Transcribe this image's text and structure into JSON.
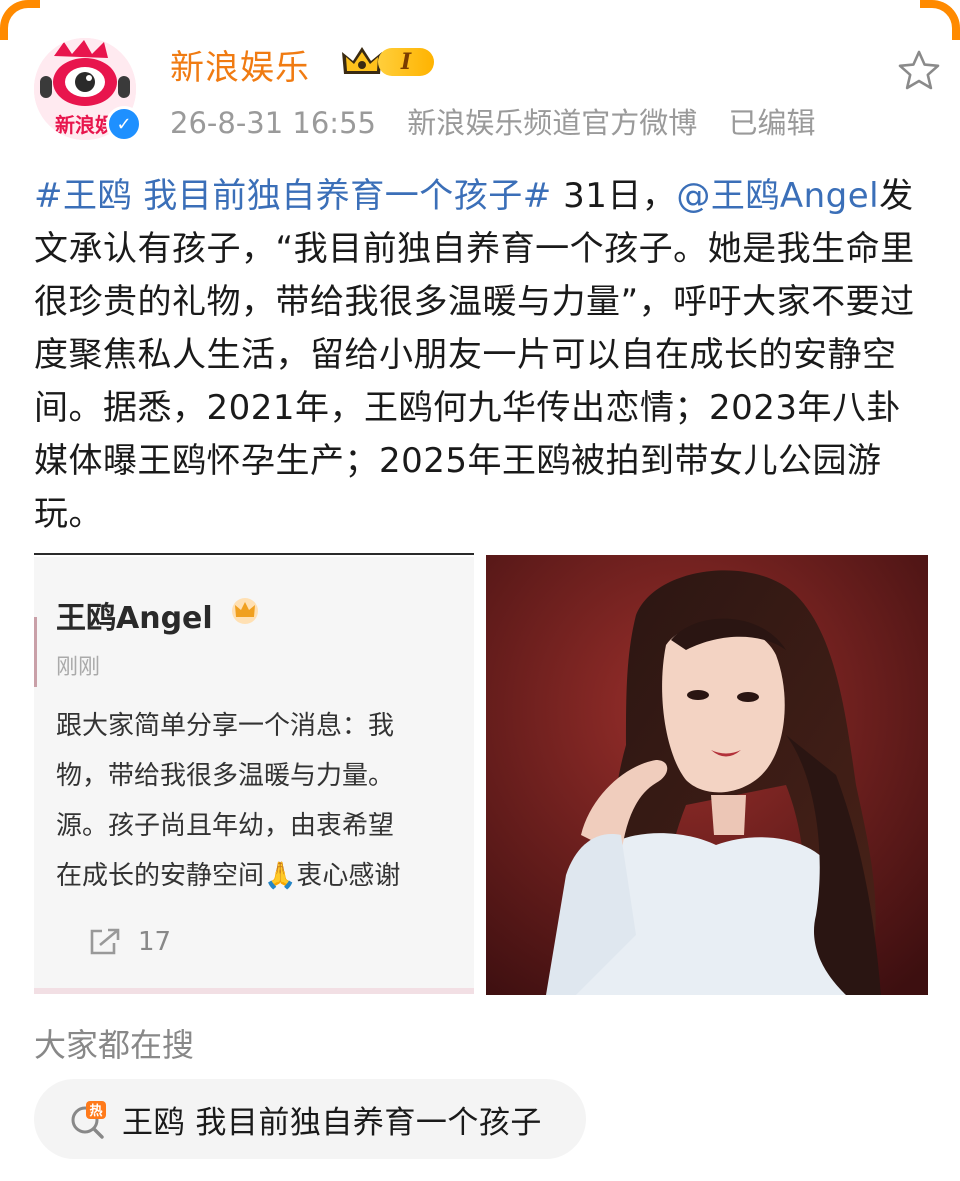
{
  "account": {
    "name": "新浪娱乐",
    "level_badge": "I",
    "timestamp": "26-8-31 16:55",
    "source": "新浪娱乐频道官方微博",
    "edited": "已编辑",
    "avatar_text": "新浪娱",
    "verified_mark": "✓"
  },
  "post": {
    "topic": "#王鸥 我目前独自养育一个孩子#",
    "text1": " 31日，",
    "mention": "@王鸥Angel",
    "text2": "发文承认有孩子，“我目前独自养育一个孩子。她是我生命里很珍贵的礼物，带给我很多温暖与力量”，呼吁大家不要过度聚焦私人生活，留给小朋友一片可以自在成长的安静空间。据悉，2021年，王鸥何九华传出恋情；2023年八卦媒体曝王鸥怀孕生产；2025年王鸥被拍到带女儿公园游玩。"
  },
  "embedded_screenshot": {
    "name": "王鸥Angel",
    "time": "刚刚",
    "lines": [
      "跟大家简单分享一个消息：我",
      "物，带给我很多温暖与力量。",
      "源。孩子尚且年幼，由衷希望",
      "在成长的安静空间🙏衷心感谢"
    ],
    "repost_count": "17"
  },
  "search": {
    "title": "大家都在搜",
    "hot_icon_label": "热",
    "hot_query": "王鸥 我目前独自养育一个孩子"
  },
  "colors": {
    "accent_orange": "#f07b12",
    "link_blue": "#3b6fb8"
  },
  "icons": {
    "favorite": "star-outline-icon",
    "repost": "repost-icon",
    "hot_search": "hot-search-icon"
  }
}
